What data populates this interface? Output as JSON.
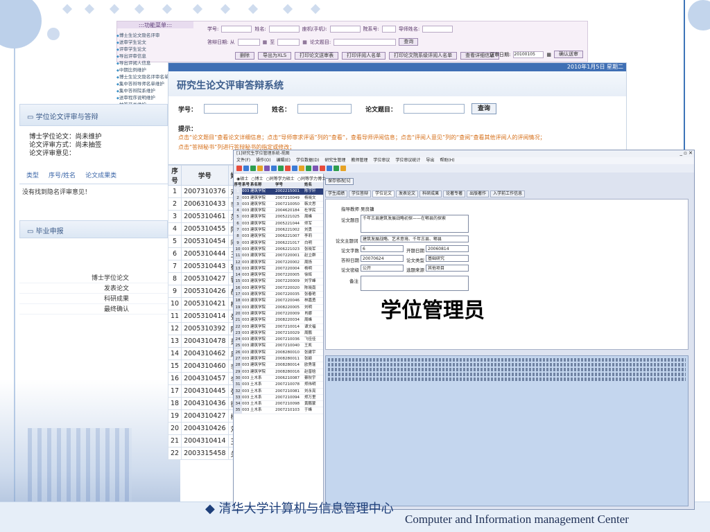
{
  "slide": {
    "bullet_text": "◆ 清华大学计算机与信息管理中心",
    "footer_center": "Computer and Information management Center"
  },
  "admin_window": {
    "menu_title": ":::功能菜单:::",
    "student_no_label": "学号:",
    "name_label": "姓名:",
    "phone_label": "座机(手机):",
    "dept_no_label": "院系号:",
    "advisor_label": "导师姓名:",
    "defense_date_label": "答辩日期: 从",
    "to_label": "至",
    "thesis_title_label": "论文题目:",
    "query_btn": "查询",
    "buttons": [
      "删除",
      "导出为XLS",
      "打印论文送审表",
      "打印评阅人名单",
      "打印论文院系级评阅人名单",
      "查看详细信息"
    ],
    "send_date_label": "送审日期:",
    "send_date_value": "20100105",
    "confirm_btn": "确认送审"
  },
  "tree_menu": [
    "博士生论文隐名评审",
    "送审学生论文",
    "评审学生论文",
    "导出评审信息",
    "导出评阅人信息",
    "中期比例维护",
    "博士生论文隐名评审名单",
    "集中答辩导师名单维护",
    "集中答辩院系维护",
    "送审程序说明维护",
    "抽签开关维护"
  ],
  "left_panel": {
    "header": "学位论文评审与答辩",
    "doctor_thesis": "博士学位论文：尚未维护",
    "review_method": "论文评审方式：尚未抽签",
    "review_opinion": "论文评审意见：",
    "tabs": [
      "类型",
      "序号/姓名",
      "论文成果类"
    ],
    "empty_msg": "没有找到隐名评审意见！"
  },
  "left_panel_b": {
    "header": "毕业申报",
    "items": [
      "博士学位论文",
      "发表论文",
      "科研成果",
      "最终确认"
    ]
  },
  "main_window": {
    "topbar_date": "2010年1月5日 星期二",
    "title": "研究生论文评审答辩系统",
    "student_no_label": "学号：",
    "name_label": "姓名：",
    "thesis_label": "论文题目：",
    "query_btn": "查询",
    "tip_label": "提示：",
    "tip_line1": "点击“论文题目”查看论文详细信息；点击“导师审求评语”列的“查看”，查看导师评阅信息；点击“评阅人意见”列的“查阅”查看其他评阅人的评阅情况；",
    "tip_line2": "点击“答辩秘书”列进行答辩秘书的指定或修改；"
  },
  "student_table": {
    "headers": [
      "序号",
      "学号",
      "姓名"
    ],
    "rows": [
      [
        "1",
        "2007310376",
        "邓斌"
      ],
      [
        "2",
        "2006310433",
        "李中"
      ],
      [
        "3",
        "2005310461",
        "范晨"
      ],
      [
        "4",
        "2005310455",
        "陈阳"
      ],
      [
        "5",
        "2005310454",
        "向小"
      ],
      [
        "6",
        "2005310444",
        "王冬"
      ],
      [
        "7",
        "2005310443",
        "崔莹"
      ],
      [
        "8",
        "2005310427",
        "郭荣"
      ],
      [
        "9",
        "2005310426",
        "郝凌"
      ],
      [
        "10",
        "2005310421",
        "杨建"
      ],
      [
        "11",
        "2005310414",
        "张鹏"
      ],
      [
        "12",
        "2005310392",
        "陈忠"
      ],
      [
        "13",
        "2004310478",
        "萧青"
      ],
      [
        "14",
        "2004310462",
        "周鑫"
      ],
      [
        "15",
        "2004310460",
        "李欣"
      ],
      [
        "16",
        "2004310457",
        "李中"
      ],
      [
        "17",
        "2004310445",
        "张荷"
      ],
      [
        "18",
        "2004310436",
        "徐佳"
      ],
      [
        "19",
        "2004310427",
        "柳恒"
      ],
      [
        "20",
        "2004310426",
        "刘川"
      ],
      [
        "21",
        "2004310414",
        "王晓"
      ],
      [
        "22",
        "2003315458",
        "关洪"
      ]
    ]
  },
  "desktop_app": {
    "title": "[1]研究生学位管理系统-视图",
    "menus": [
      "文件(F)",
      "操作(O)",
      "编辑(E)",
      "学位数据(D)",
      "研究生管理",
      "教师管理",
      "学位审议",
      "学位审议统计",
      "导出",
      "帮助(H)"
    ],
    "radios": [
      "硕士",
      "博士",
      "同等学力硕士",
      "同等学力博士"
    ],
    "list_headers": [
      "序号",
      "系号",
      "系名称",
      "学号",
      "姓名"
    ],
    "list_rows": [
      [
        "1",
        "003",
        "建筑学院",
        "2002215001",
        "陈宇轩"
      ],
      [
        "2",
        "003",
        "建筑学院",
        "2007210049",
        "杨晓文"
      ],
      [
        "3",
        "003",
        "建筑学院",
        "2007210050",
        "韩文思"
      ],
      [
        "4",
        "003",
        "建筑学院",
        "2004620184",
        "杜学民"
      ],
      [
        "5",
        "003",
        "建筑学院",
        "2005221025",
        "周峰"
      ],
      [
        "6",
        "003",
        "建筑学院",
        "2005221044",
        "师军"
      ],
      [
        "7",
        "003",
        "建筑学院",
        "2006221002",
        "刘勇"
      ],
      [
        "8",
        "003",
        "建筑学院",
        "2006221007",
        "李莉"
      ],
      [
        "9",
        "003",
        "建筑学院",
        "2006221017",
        "白明"
      ],
      [
        "10",
        "003",
        "建筑学院",
        "2006221023",
        "张晓军"
      ],
      [
        "11",
        "003",
        "建筑学院",
        "2007220001",
        "赵立群"
      ],
      [
        "12",
        "003",
        "建筑学院",
        "2007220002",
        "周扬"
      ],
      [
        "13",
        "003",
        "建筑学院",
        "2007220004",
        "杨明"
      ],
      [
        "14",
        "003",
        "建筑学院",
        "2007220005",
        "徐辉"
      ],
      [
        "15",
        "003",
        "建筑学院",
        "2007220009",
        "刘宇峰"
      ],
      [
        "16",
        "003",
        "建筑学院",
        "2007220020",
        "陈晓南"
      ],
      [
        "17",
        "003",
        "建筑学院",
        "2007220035",
        "张春艳"
      ],
      [
        "18",
        "003",
        "建筑学院",
        "2007220046",
        "林嘉勇"
      ],
      [
        "19",
        "003",
        "建筑学院",
        "2008220005",
        "刘明"
      ],
      [
        "20",
        "003",
        "建筑学院",
        "2007220009",
        "肖娜"
      ],
      [
        "21",
        "003",
        "建筑学院",
        "2008220034",
        "周峰"
      ],
      [
        "22",
        "003",
        "建筑学院",
        "2007210014",
        "谭文福"
      ],
      [
        "23",
        "003",
        "建筑学院",
        "2007210029",
        "周鹏"
      ],
      [
        "24",
        "003",
        "建筑学院",
        "2007210036",
        "飞佳佳"
      ],
      [
        "25",
        "003",
        "建筑学院",
        "2007210040",
        "王凯"
      ],
      [
        "26",
        "003",
        "建筑学院",
        "2008280010",
        "张建宇"
      ],
      [
        "27",
        "003",
        "建筑学院",
        "2008280011",
        "张颖"
      ],
      [
        "28",
        "003",
        "建筑学院",
        "2008280014",
        "欧秀蓬"
      ],
      [
        "29",
        "003",
        "建筑学院",
        "2008280016",
        "赵普晗"
      ],
      [
        "30",
        "003",
        "土木系",
        "2006210087",
        "蔡秋宇"
      ],
      [
        "31",
        "003",
        "土木系",
        "2007210078",
        "郑伟明"
      ],
      [
        "32",
        "003",
        "土木系",
        "2007210081",
        "刘永亮"
      ],
      [
        "33",
        "003",
        "土木系",
        "2007210094",
        "郑万里"
      ],
      [
        "34",
        "003",
        "土木系",
        "2007210098",
        "黄鹏蒙"
      ],
      [
        "35",
        "003",
        "土木系",
        "2007210103",
        "于峰"
      ]
    ],
    "submit_btn": "保存修改[S]",
    "tabs": [
      "学生成绩",
      "学位答辩",
      "学位论文",
      "发表论文",
      "科研成果",
      "论著专著",
      "出版著作",
      "入学前工作信息"
    ],
    "form": {
      "advisor_label": "指导教师",
      "advisor_value": "吴良镛",
      "thesis_title_label": "论文题目",
      "thesis_title_value": "千年古县建筑发展战略初探——在郫县的探索",
      "keywords_label": "论文主题词",
      "keywords_value": "建筑发展战略、艺术意境、千年古县、郫县",
      "word_count_label": "论文字数",
      "word_count_value": "6",
      "start_date_label": "开题日期",
      "start_date_value": "20060814",
      "defense_date_label": "答辩日期",
      "defense_date_value": "20070624",
      "type_label": "论文类型",
      "type_value": "基础研究",
      "secret_label": "论文密级",
      "secret_value": "公开",
      "source_label": "选题来源",
      "source_value": "其他项目",
      "remark_label": "备注"
    },
    "overlay_title": "学位管理员"
  }
}
